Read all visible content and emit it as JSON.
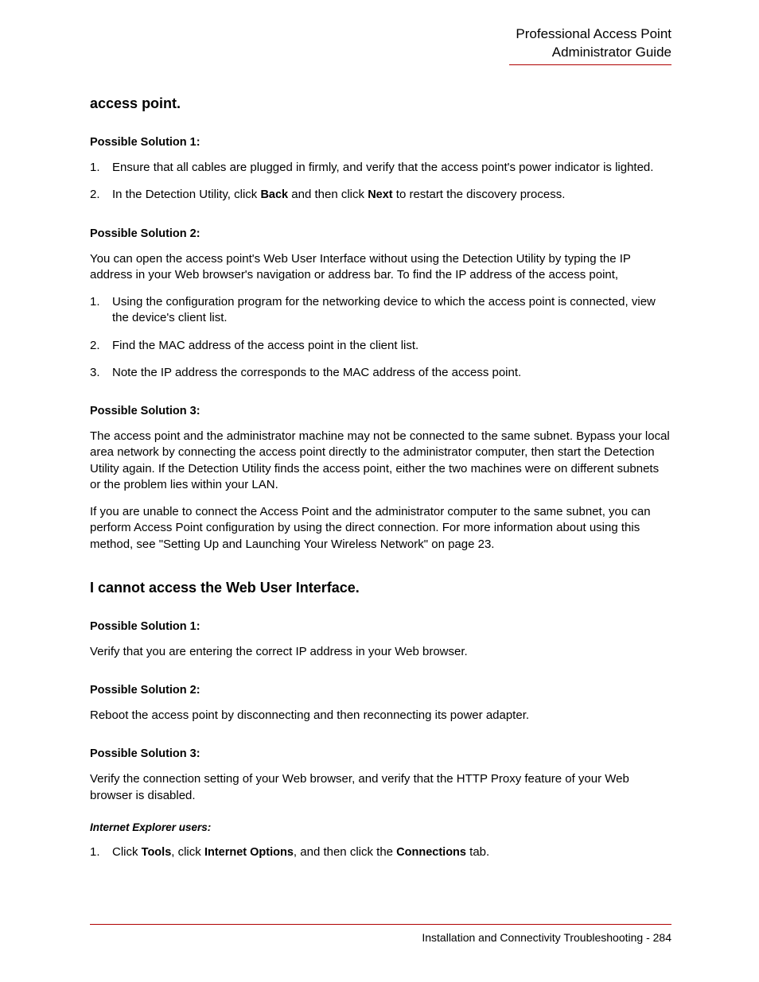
{
  "header": {
    "line1": "Professional Access Point",
    "line2": "Administrator Guide"
  },
  "section1": {
    "title": "access point.",
    "sol1": {
      "heading": "Possible Solution 1:",
      "items": [
        "Ensure that all cables are plugged in firmly, and verify that the access point's power indicator is lighted.",
        [
          "In the Detection Utility, click ",
          "Back",
          " and then click ",
          "Next",
          " to restart the discovery process."
        ]
      ]
    },
    "sol2": {
      "heading": "Possible Solution 2:",
      "intro": "You can open the access point's Web User Interface without using the Detection Utility by typing the IP address in your Web browser's navigation or address bar. To find the IP address of the access point,",
      "items": [
        "Using the configuration program for the networking device to which the access point is connected, view the device's client list.",
        "Find the MAC address of the access point in the client list.",
        "Note the IP address the corresponds to the MAC address of the access point."
      ]
    },
    "sol3": {
      "heading": "Possible Solution 3:",
      "p1": "The access point and the administrator machine may not be connected to the same subnet. Bypass your local area network by connecting the access point directly to the administrator computer, then start the Detection Utility again. If the Detection Utility finds the access point, either the two machines were on different subnets or the problem lies within your LAN.",
      "p2": "If you are unable to connect the Access Point and the administrator computer to the same subnet, you can perform Access Point configuration by using the direct connection. For more information about using this method, see \"Setting Up and Launching Your Wireless Network\" on page 23."
    }
  },
  "section2": {
    "title": "I cannot access the Web User Interface.",
    "sol1": {
      "heading": "Possible Solution 1:",
      "p": "Verify that you are entering the correct IP address in your Web browser."
    },
    "sol2": {
      "heading": "Possible Solution 2:",
      "p": "Reboot the access point by disconnecting and then reconnecting its power adapter."
    },
    "sol3": {
      "heading": "Possible Solution  3:",
      "p": "Verify the connection setting of your Web browser, and verify that the HTTP Proxy feature of your Web browser is disabled.",
      "sub": "Internet Explorer users:",
      "items": [
        [
          "Click ",
          "Tools",
          ", click ",
          "Internet Options",
          ", and then click the ",
          "Connections",
          " tab."
        ]
      ]
    }
  },
  "footer": {
    "text": "Installation and Connectivity Troubleshooting - 284"
  }
}
